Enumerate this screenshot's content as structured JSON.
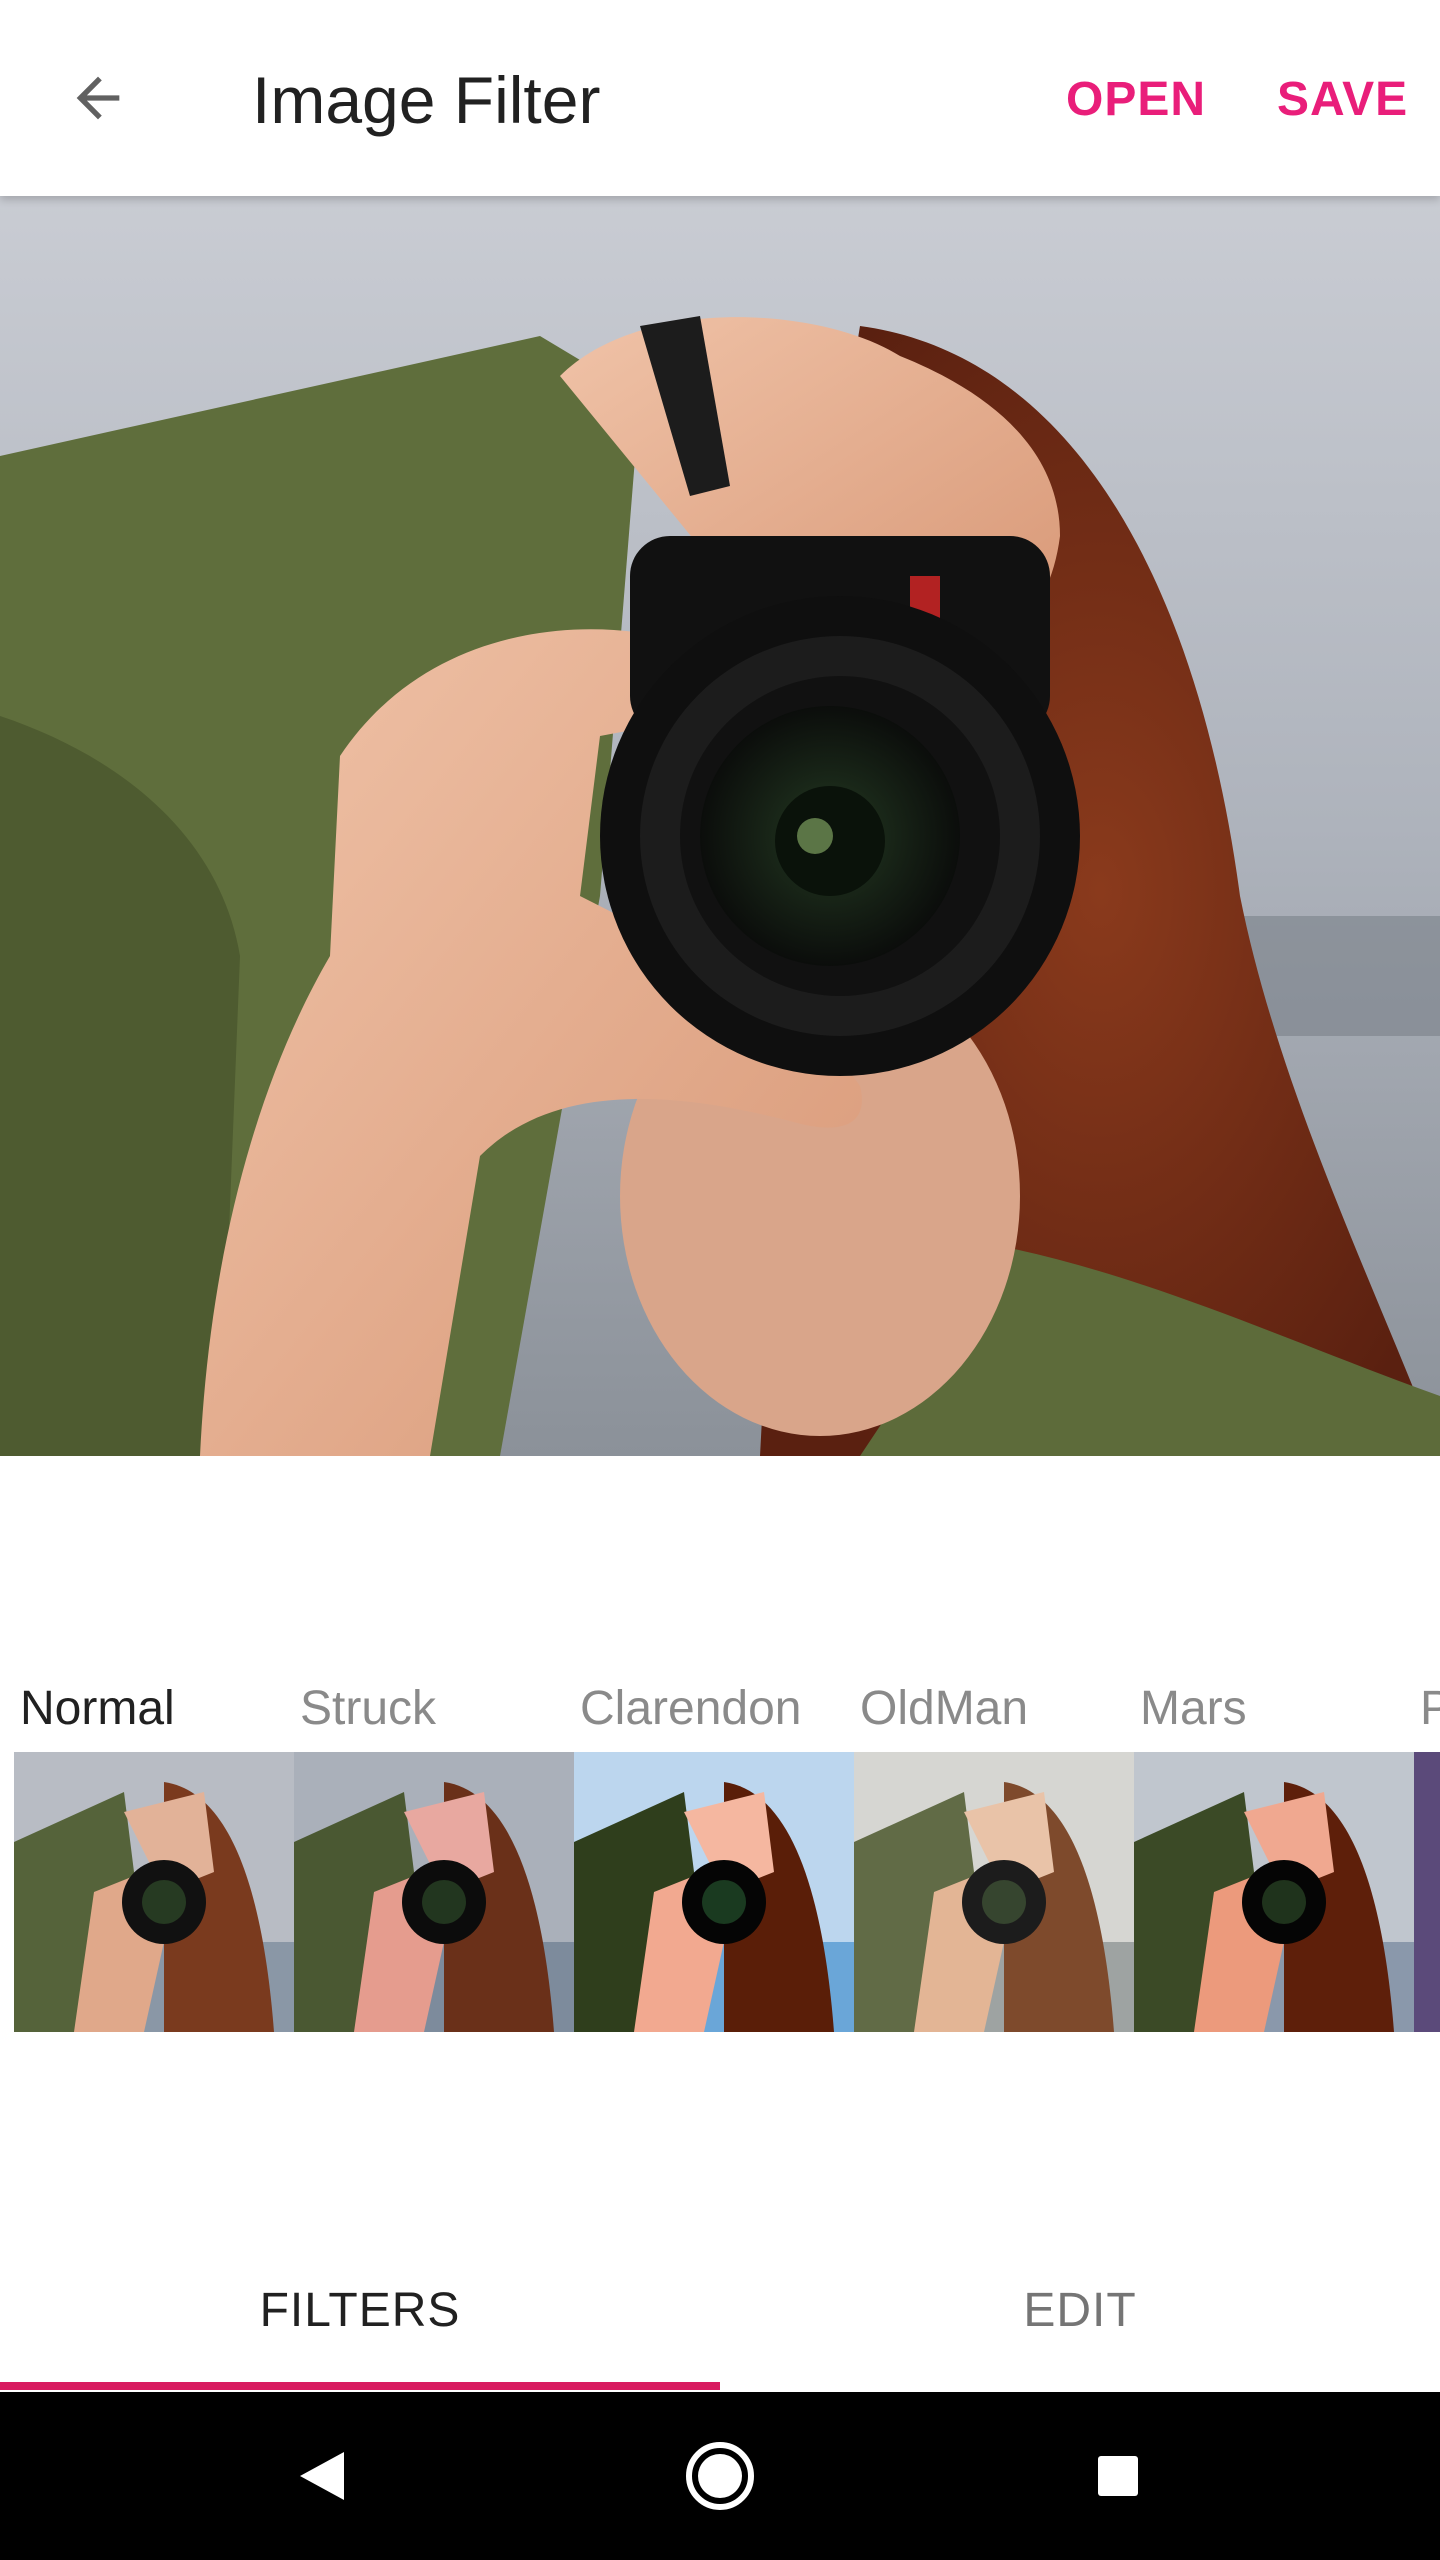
{
  "appbar": {
    "title": "Image Filter",
    "back_icon": "arrow-back-icon",
    "open_label": "OPEN",
    "save_label": "SAVE",
    "accent_color": "#E91E7A"
  },
  "filters": [
    {
      "label": "Normal",
      "active": true
    },
    {
      "label": "Struck",
      "active": false
    },
    {
      "label": "Clarendon",
      "active": false
    },
    {
      "label": "OldMan",
      "active": false
    },
    {
      "label": "Mars",
      "active": false
    },
    {
      "label": "P",
      "active": false
    }
  ],
  "tabs": {
    "filters_label": "FILTERS",
    "edit_label": "EDIT",
    "selected": "FILTERS",
    "indicator_color": "#D81B60"
  },
  "navbar": {
    "back_icon": "triangle-back-icon",
    "home_icon": "circle-home-icon",
    "recent_icon": "square-recents-icon"
  }
}
